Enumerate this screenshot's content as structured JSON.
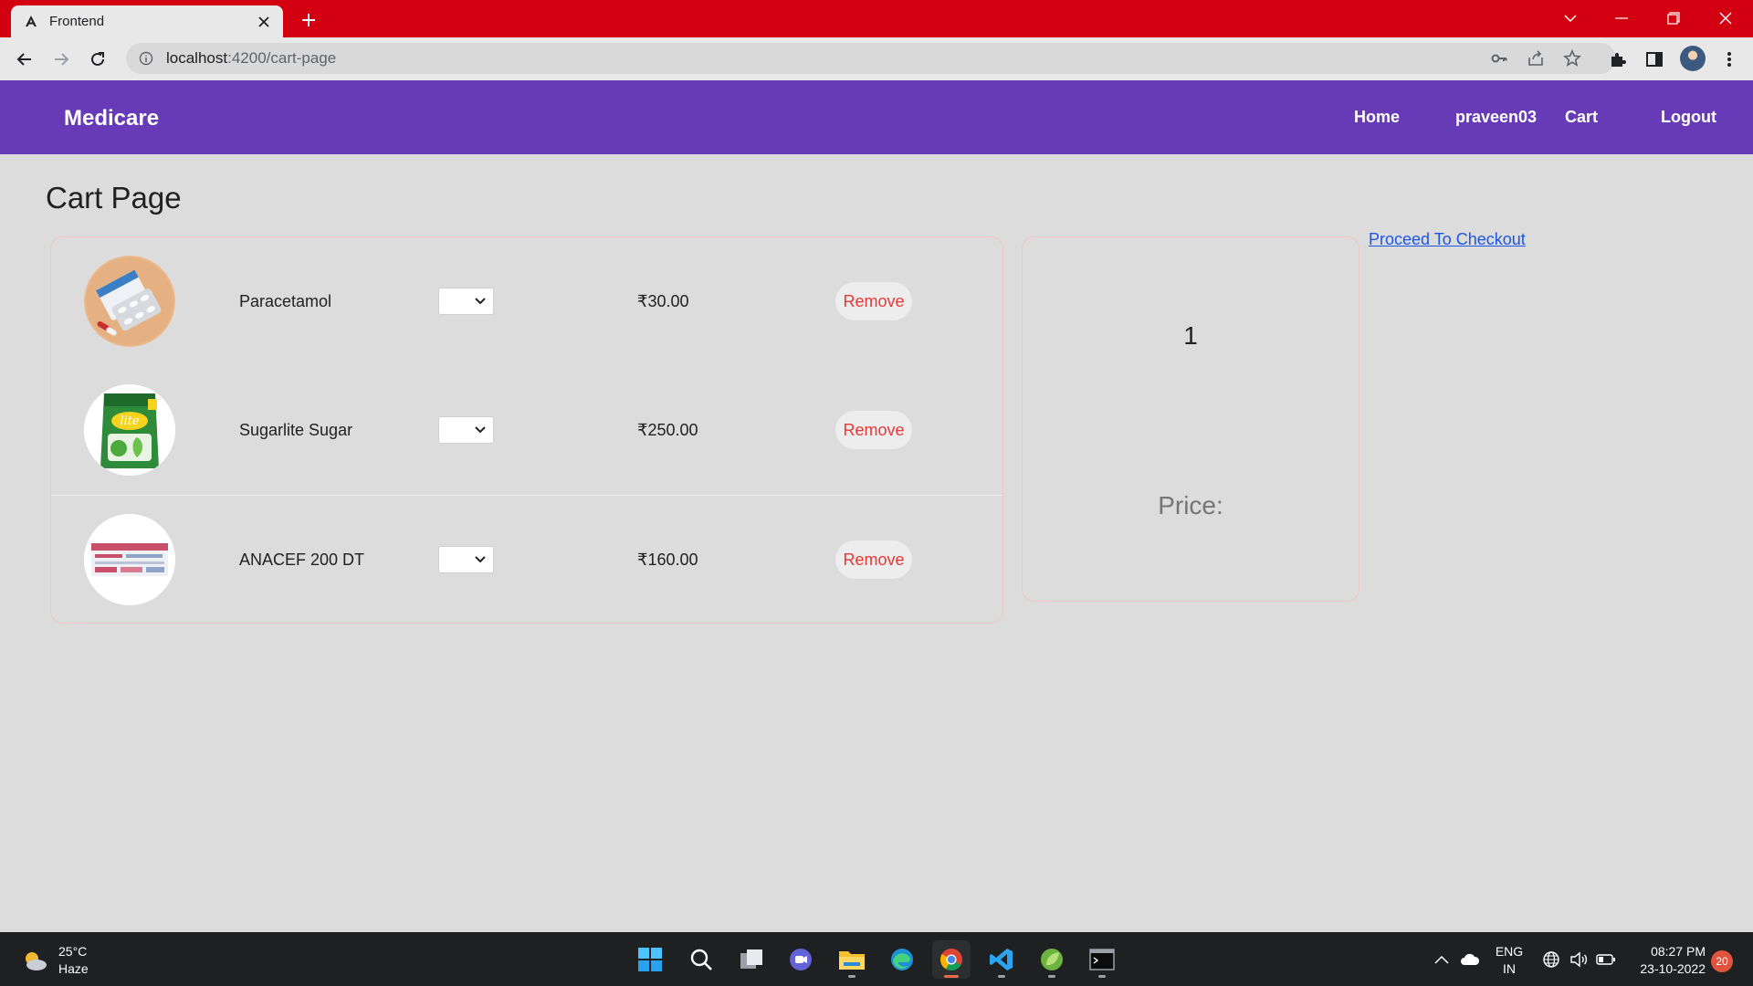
{
  "browser": {
    "tab_title": "Frontend",
    "url_host": "localhost",
    "url_path": ":4200/cart-page"
  },
  "app": {
    "brand": "Medicare",
    "nav": {
      "home": "Home",
      "user": "praveen03",
      "cart": "Cart",
      "logout": "Logout"
    },
    "accent_color": "#673ab7"
  },
  "page": {
    "title": "Cart Page",
    "checkout_link": "Proceed To Checkout"
  },
  "cart": {
    "items": [
      {
        "name": "Paracetamol",
        "quantity": "",
        "price": "₹30.00",
        "remove_label": "Remove"
      },
      {
        "name": "Sugarlite Sugar",
        "quantity": "",
        "price": "₹250.00",
        "remove_label": "Remove"
      },
      {
        "name": "ANACEF 200 DT",
        "quantity": "",
        "price": "₹160.00",
        "remove_label": "Remove"
      }
    ]
  },
  "summary": {
    "count": "1",
    "price_label": "Price:"
  },
  "taskbar": {
    "weather_temp": "25°C",
    "weather_desc": "Haze",
    "lang_top": "ENG",
    "lang_bottom": "IN",
    "time": "08:27 PM",
    "date": "23-10-2022",
    "notifications": "20"
  }
}
